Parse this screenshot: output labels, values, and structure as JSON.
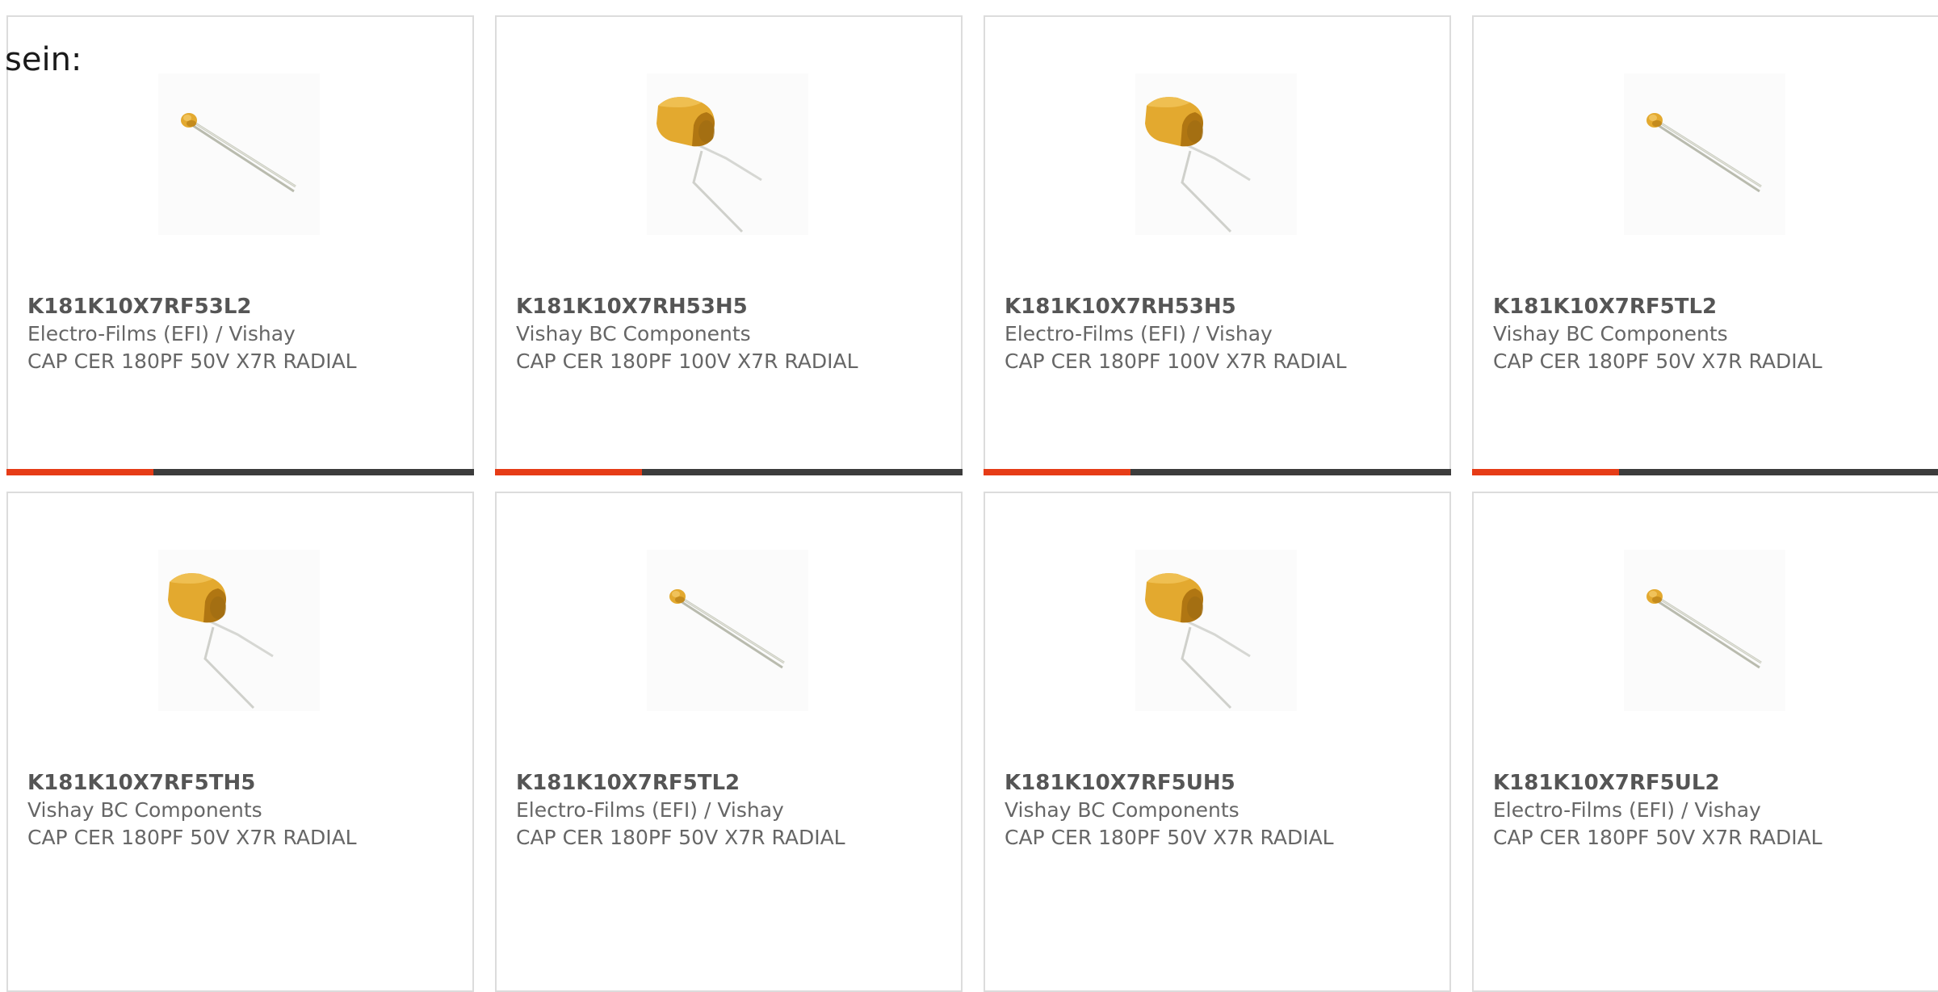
{
  "intro_text": "sein:",
  "colors": {
    "accent": "#e63c17",
    "bar_track": "#3c3c3c",
    "card_border": "#dcdcdc",
    "text_muted": "#666666",
    "capacitor_body": "#e3a92f"
  },
  "products": [
    {
      "part": "K181K10X7RF53L2",
      "manufacturer": "Electro-Films (EFI) / Vishay",
      "description": "CAP CER 180PF 50V X7R RADIAL",
      "image": "small-disc-capacitor"
    },
    {
      "part": "K181K10X7RH53H5",
      "manufacturer": "Vishay BC Components",
      "description": "CAP CER 180PF 100V X7R RADIAL",
      "image": "large-block-capacitor"
    },
    {
      "part": "K181K10X7RH53H5",
      "manufacturer": "Electro-Films (EFI) / Vishay",
      "description": "CAP CER 180PF 100V X7R RADIAL",
      "image": "large-block-capacitor"
    },
    {
      "part": "K181K10X7RF5TL2",
      "manufacturer": "Vishay BC Components",
      "description": "CAP CER 180PF 50V X7R RADIAL",
      "image": "small-disc-capacitor"
    },
    {
      "part": "K181K10X7RF5TH5",
      "manufacturer": "Vishay BC Components",
      "description": "CAP CER 180PF 50V X7R RADIAL",
      "image": "large-block-capacitor"
    },
    {
      "part": "K181K10X7RF5TL2",
      "manufacturer": "Electro-Films (EFI) / Vishay",
      "description": "CAP CER 180PF 50V X7R RADIAL",
      "image": "small-disc-capacitor"
    },
    {
      "part": "K181K10X7RF5UH5",
      "manufacturer": "Vishay BC Components",
      "description": "CAP CER 180PF 50V X7R RADIAL",
      "image": "large-block-capacitor"
    },
    {
      "part": "K181K10X7RF5UL2",
      "manufacturer": "Electro-Films (EFI) / Vishay",
      "description": "CAP CER 180PF 50V X7R RADIAL",
      "image": "small-disc-capacitor"
    }
  ]
}
